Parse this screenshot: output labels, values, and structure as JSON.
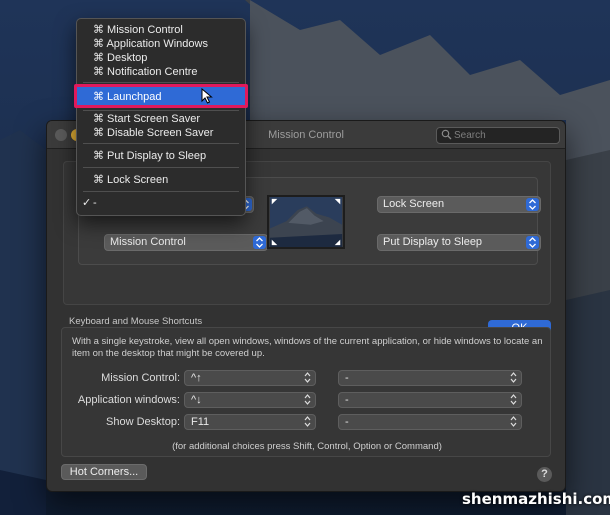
{
  "window": {
    "title": "Mission Control",
    "search_placeholder": "Search"
  },
  "hot_corners": {
    "top_left": "-",
    "top_right": "Lock Screen",
    "bottom_left": "Mission Control",
    "bottom_right": "Put Display to Sleep",
    "ok_label": "OK"
  },
  "menu": {
    "items": [
      "⌘ Mission Control",
      "⌘ Application Windows",
      "⌘ Desktop",
      "⌘ Notification Centre",
      "⌘ Launchpad",
      "⌘ Start Screen Saver",
      "⌘ Disable Screen Saver",
      "⌘ Put Display to Sleep",
      "⌘ Lock Screen",
      "-"
    ],
    "highlighted_index": 4,
    "checked_index": 9,
    "check_glyph": "✓"
  },
  "keyboard": {
    "heading": "Keyboard and Mouse Shortcuts",
    "description": "With a single keystroke, view all open windows, windows of the current application, or hide windows to locate an item on the desktop that might be covered up.",
    "rows": [
      {
        "label": "Mission Control:",
        "key": "^↑",
        "mouse": "-"
      },
      {
        "label": "Application windows:",
        "key": "^↓",
        "mouse": "-"
      },
      {
        "label": "Show Desktop:",
        "key": "F11",
        "mouse": "-"
      }
    ],
    "note": "(for additional choices press Shift, Control, Option or Command)"
  },
  "footer": {
    "hot_corners_label": "Hot Corners...",
    "help_label": "?"
  },
  "watermark": "shenmazhishi.com"
}
